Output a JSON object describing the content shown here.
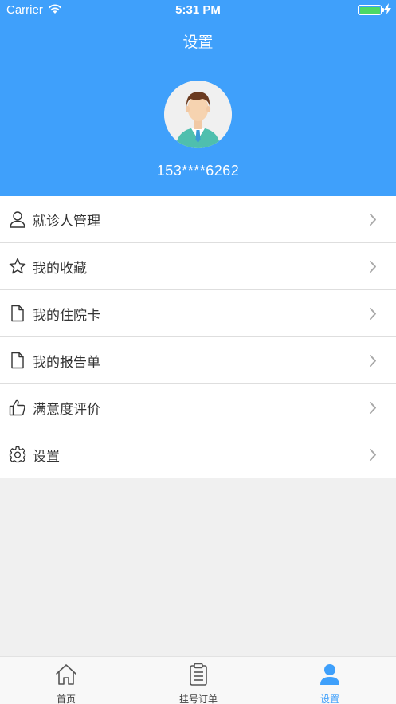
{
  "status_bar": {
    "carrier": "Carrier",
    "time": "5:31 PM"
  },
  "header": {
    "title": "设置",
    "phone": "153****6262"
  },
  "menu": {
    "items": [
      {
        "label": "就诊人管理",
        "icon": "user-icon"
      },
      {
        "label": "我的收藏",
        "icon": "star-icon"
      },
      {
        "label": "我的住院卡",
        "icon": "document-icon"
      },
      {
        "label": "我的报告单",
        "icon": "document-icon"
      },
      {
        "label": "满意度评价",
        "icon": "thumbs-up-icon"
      },
      {
        "label": "设置",
        "icon": "gear-icon"
      }
    ]
  },
  "tabbar": {
    "tabs": [
      {
        "label": "首页",
        "icon": "home-icon"
      },
      {
        "label": "挂号订单",
        "icon": "clipboard-icon"
      },
      {
        "label": "设置",
        "icon": "person-icon",
        "active": true
      }
    ]
  },
  "colors": {
    "primary": "#3fa0fb",
    "battery": "#4cd964"
  }
}
